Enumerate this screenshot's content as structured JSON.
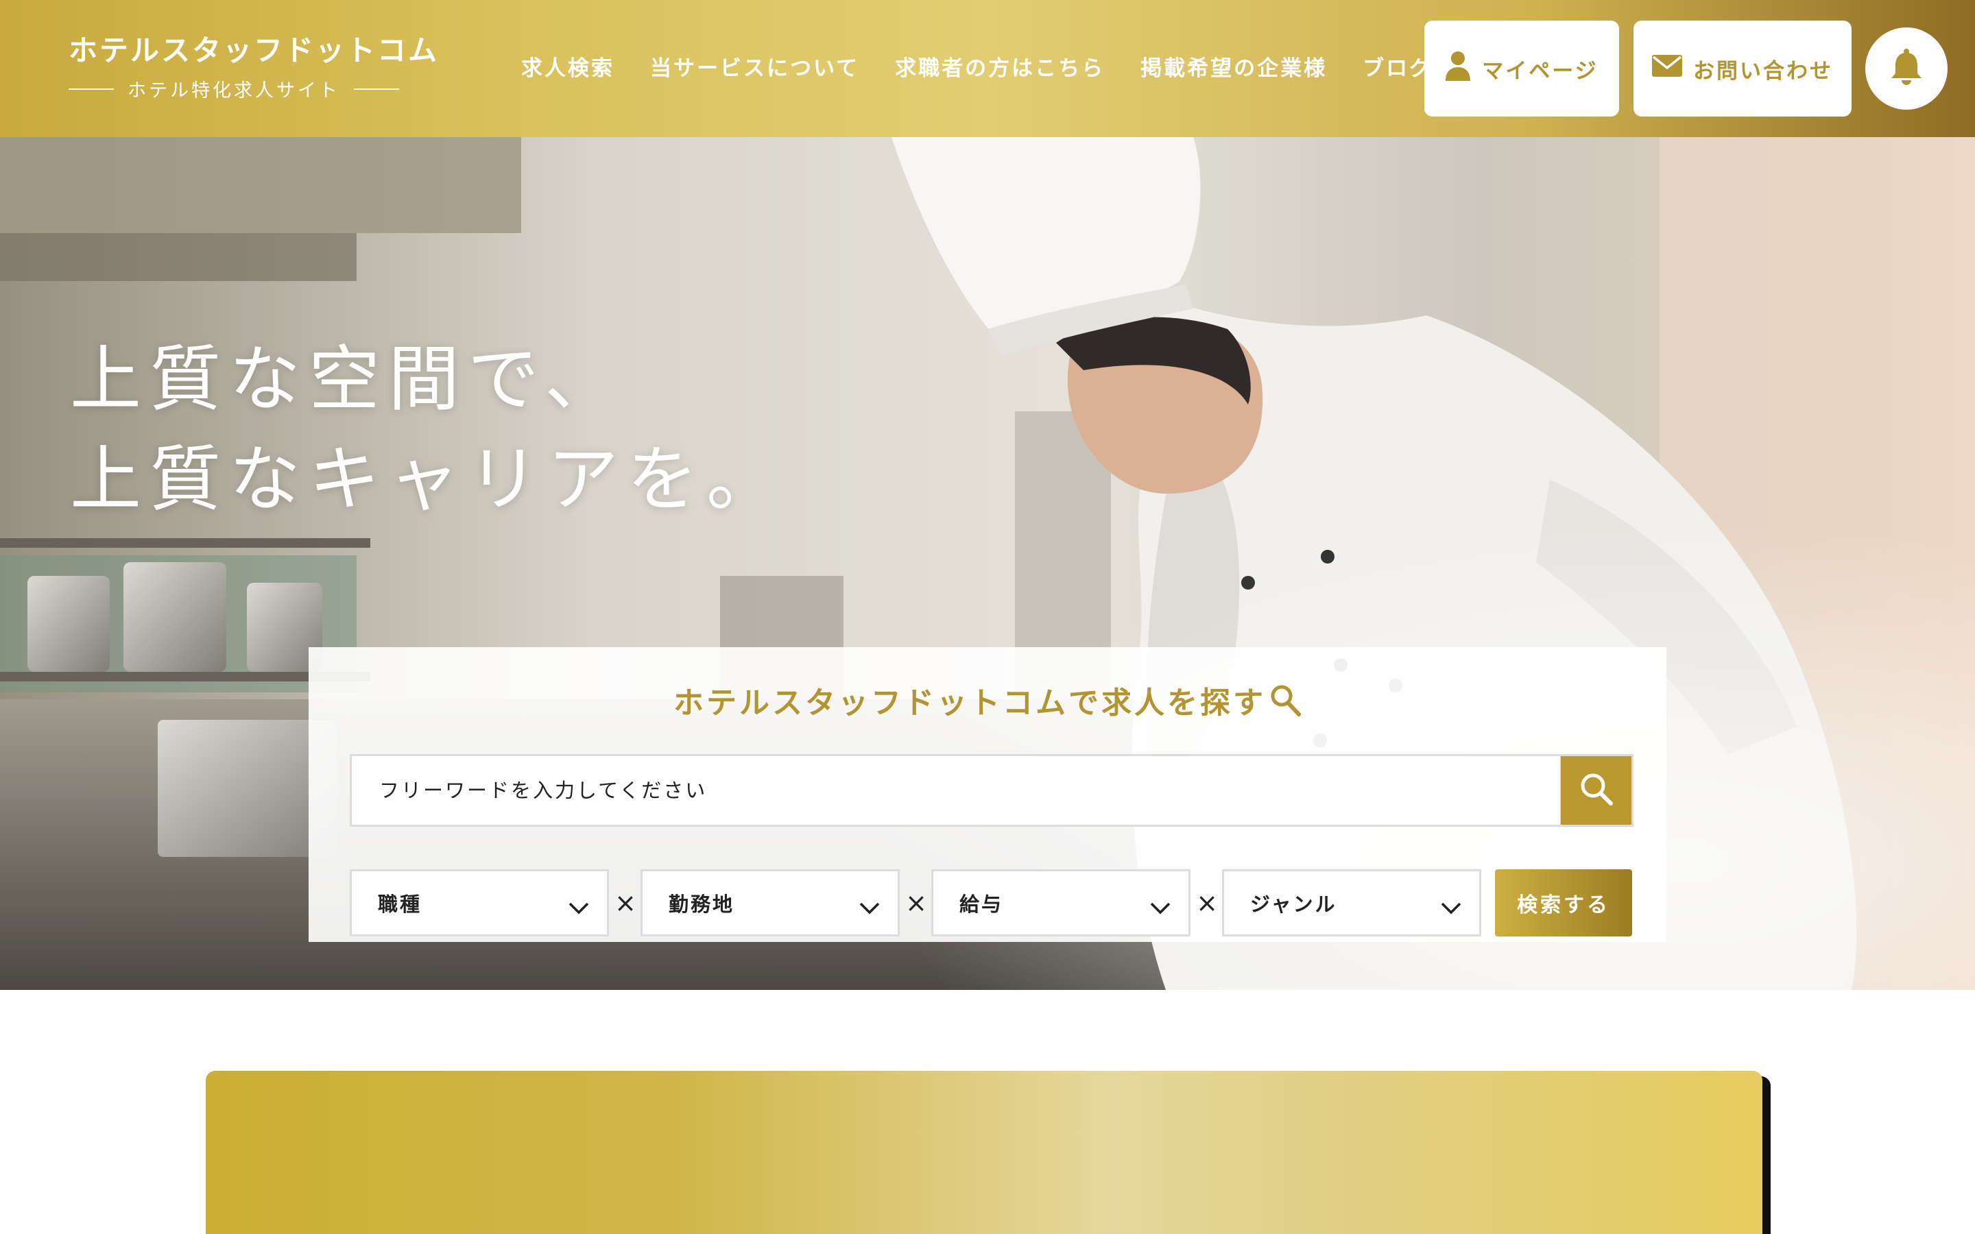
{
  "header": {
    "logo_title": "ホテルスタッフドットコム",
    "logo_subtitle": "ホテル特化求人サイト",
    "nav": [
      {
        "label": "求人検索"
      },
      {
        "label": "当サービスについて"
      },
      {
        "label": "求職者の方はこちら"
      },
      {
        "label": "掲載希望の企業様"
      },
      {
        "label": "ブログ"
      }
    ],
    "mypage_label": "マイページ",
    "contact_label": "お問い合わせ",
    "icons": {
      "mypage": "user-icon",
      "contact": "mail-icon",
      "notification": "bell-icon"
    }
  },
  "hero": {
    "catch_line1": "上質な空間で、",
    "catch_line2": "上質なキャリアを。",
    "image_icon": "chef-in-kitchen-photo"
  },
  "search": {
    "title": "ホテルスタッフドットコムで求人を探す",
    "placeholder": "フリーワードを入力してください",
    "filters": [
      {
        "label": "職種"
      },
      {
        "label": "勤務地"
      },
      {
        "label": "給与"
      },
      {
        "label": "ジャンル"
      }
    ],
    "separator": "×",
    "submit_label": "検索する"
  },
  "colors": {
    "brand_gold": "#b29431",
    "header_gradient_start": "#c8aa3e",
    "header_gradient_end": "#8e6c24",
    "search_button": "#b9992f",
    "banner_gold": "#cbaf34"
  }
}
